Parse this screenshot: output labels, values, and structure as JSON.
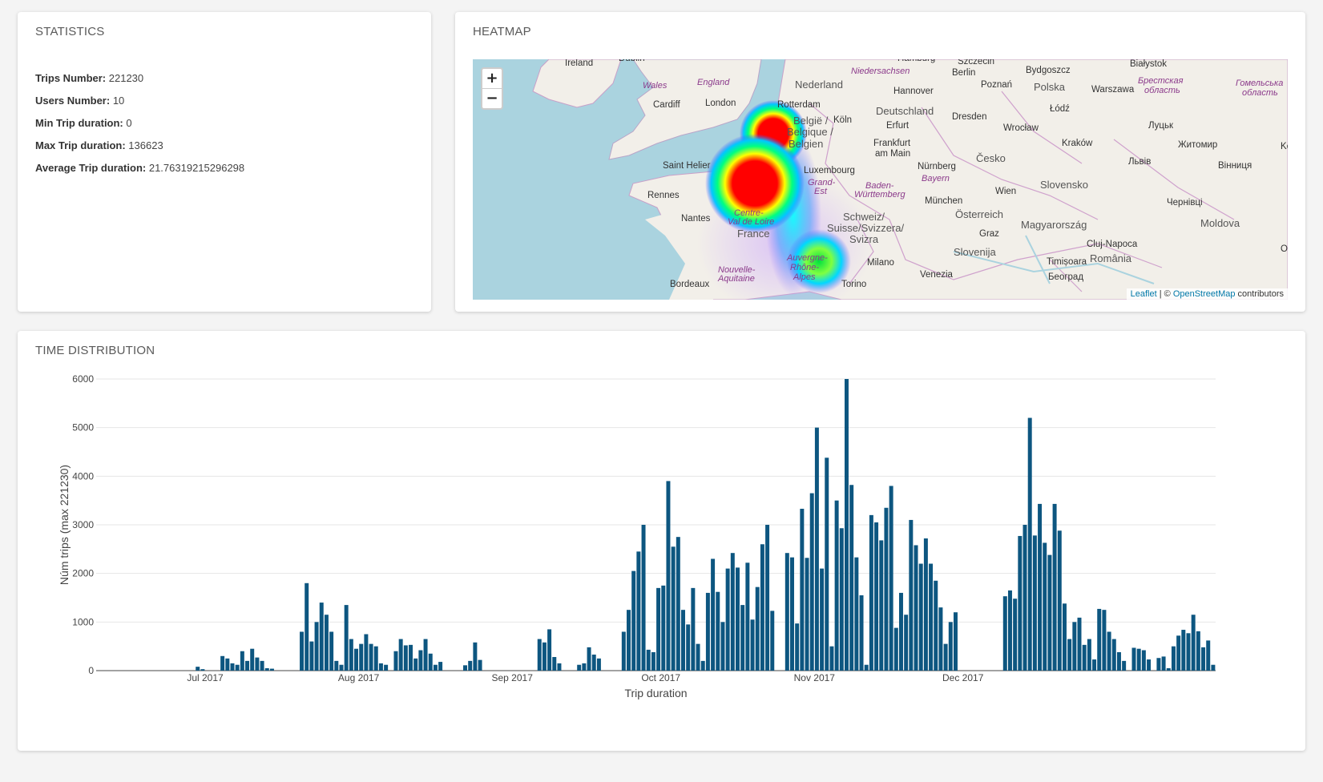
{
  "statistics": {
    "title": "STATISTICS",
    "rows": [
      {
        "label": "Trips Number:",
        "value": "221230"
      },
      {
        "label": "Users Number:",
        "value": "10"
      },
      {
        "label": "Min Trip duration:",
        "value": "0"
      },
      {
        "label": "Max Trip duration:",
        "value": "136623"
      },
      {
        "label": "Average Trip duration:",
        "value": "21.76319215296298"
      }
    ]
  },
  "heatmap": {
    "title": "HEATMAP",
    "zoom_in": "+",
    "zoom_out": "−",
    "attribution": {
      "leaflet": "Leaflet",
      "sep": " | © ",
      "osm": "OpenStreetMap",
      "suffix": " contributors"
    },
    "cities": [
      "Ireland",
      "Dublin",
      "Cardiff",
      "London",
      "Rotterdam",
      "Nederland",
      "Hannover",
      "Berlin",
      "Szczecin",
      "Bydgoszcz",
      "Białystok",
      "Poznań",
      "Warszawa",
      "Polska",
      "Łódź",
      "Köln",
      "Deutschland",
      "Erfurt",
      "Dresden",
      "Wrocław",
      "Frankfurt",
      "am Main",
      "Nürnberg",
      "Kraków",
      "Česko",
      "Luxembourg",
      "München",
      "Wien",
      "Slovensko",
      "Saint Helier",
      "Rennes",
      "Nantes",
      "France",
      "Bordeaux",
      "Schweiz/",
      "Suisse/Svizzera/",
      "Svizra",
      "Milano",
      "Torino",
      "Venezia",
      "Österreich",
      "Graz",
      "Magyarország",
      "Slovenija",
      "Timișoara",
      "Cluj-Napoca",
      "România",
      "Beograd",
      "Moldova",
      "Луцьк",
      "Житомир",
      "Львів",
      "Вінниця",
      "Чернівці",
      "Bayern",
      "Baden-",
      "Württemberg",
      "Grand-",
      "Est",
      "Centre-",
      "Val de Loire",
      "Nouvelle-",
      "Aquitaine",
      "Auvergne-",
      "Rhône-",
      "Alpes",
      "Wales",
      "England",
      "Niedersachsen",
      "Hamburg",
      "België /",
      "Belgique /",
      "Belgien",
      "Брестская",
      "область",
      "Гомельська",
      "область",
      "Kö",
      "O"
    ],
    "heat_colors": {
      "core": "#ff0000",
      "mid": "#ffff00",
      "outer": "#00ffff",
      "edge": "#0000ff",
      "haze": "#c8a0ff"
    }
  },
  "time_distribution": {
    "title": "TIME DISTRIBUTION",
    "chart_data": {
      "type": "bar",
      "xlabel": "Trip duration",
      "ylabel": "Núm trips (max 221230)",
      "ylim": [
        0,
        6000
      ],
      "yticks": [
        0,
        1000,
        2000,
        3000,
        4000,
        5000,
        6000
      ],
      "x_start": "2017-06-09",
      "x_tick_labels": [
        {
          "label": "Jul 2017",
          "date": "2017-07-01"
        },
        {
          "label": "Aug 2017",
          "date": "2017-08-01"
        },
        {
          "label": "Sep 2017",
          "date": "2017-09-01"
        },
        {
          "label": "Oct 2017",
          "date": "2017-10-01"
        },
        {
          "label": "Nov 2017",
          "date": "2017-11-01"
        },
        {
          "label": "Dec 2017",
          "date": "2017-12-01"
        }
      ],
      "bar_color": "#0d5680",
      "values": [
        0,
        0,
        0,
        0,
        0,
        0,
        0,
        0,
        0,
        0,
        0,
        0,
        0,
        0,
        0,
        0,
        0,
        0,
        0,
        0,
        80,
        30,
        0,
        0,
        0,
        300,
        250,
        150,
        120,
        400,
        200,
        450,
        270,
        200,
        50,
        40,
        0,
        0,
        0,
        0,
        0,
        800,
        1800,
        600,
        1000,
        1400,
        1150,
        800,
        200,
        120,
        1350,
        650,
        450,
        550,
        750,
        550,
        500,
        150,
        120,
        0,
        400,
        650,
        520,
        530,
        250,
        420,
        650,
        350,
        120,
        180,
        0,
        0,
        0,
        0,
        110,
        200,
        580,
        220,
        0,
        0,
        0,
        0,
        0,
        0,
        0,
        0,
        0,
        0,
        0,
        650,
        580,
        850,
        280,
        150,
        0,
        0,
        0,
        120,
        150,
        480,
        330,
        250,
        0,
        0,
        0,
        0,
        800,
        1250,
        2050,
        2450,
        3000,
        430,
        380,
        1700,
        1750,
        3900,
        2550,
        2750,
        1250,
        950,
        1700,
        550,
        200,
        1600,
        2300,
        1620,
        1000,
        2100,
        2420,
        2120,
        1350,
        2220,
        1050,
        1720,
        2600,
        3000,
        1230,
        0,
        0,
        2420,
        2330,
        970,
        3330,
        2320,
        3650,
        5000,
        2100,
        4380,
        500,
        3500,
        2930,
        6000,
        3820,
        2330,
        1550,
        120,
        3200,
        3050,
        2680,
        3350,
        3800,
        880,
        1600,
        1150,
        3100,
        2580,
        2200,
        2720,
        2200,
        1850,
        1300,
        550,
        1000,
        1200,
        0,
        0,
        0,
        0,
        0,
        0,
        0,
        0,
        0,
        1530,
        1650,
        1480,
        2770,
        3000,
        5200,
        2780,
        3430,
        2630,
        2380,
        3430,
        2880,
        1380,
        650,
        1000,
        1090,
        530,
        650,
        230,
        1270,
        1250,
        800,
        650,
        380,
        200,
        0,
        470,
        450,
        420,
        230,
        0,
        260,
        290,
        50,
        500,
        720,
        840,
        770,
        1150,
        810,
        480,
        620,
        120
      ]
    }
  }
}
